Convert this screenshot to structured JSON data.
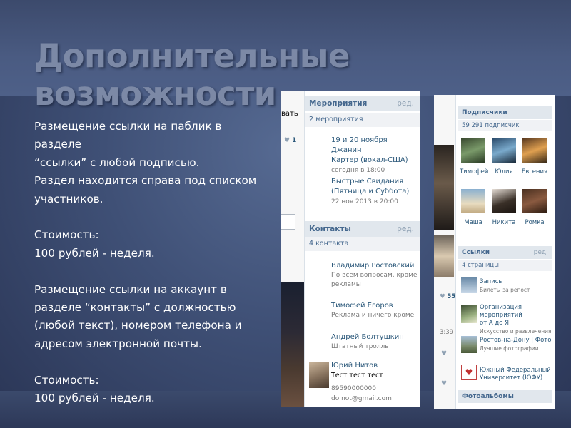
{
  "slide": {
    "title": "Дополнительные возможности",
    "paragraphs": [
      [
        "Размещение ссылки на паблик в разделе",
        "“ссылки” с любой подписью.",
        "Раздел находится справа под списком",
        "участников."
      ],
      [
        "Стоимость:",
        "100 рублей - неделя."
      ],
      [
        "Размещение ссылки на аккаунт в",
        "разделе “контакты” с должностью",
        "(любой текст), номером телефона и",
        "адресом электронной почты."
      ],
      [
        "Стоимость:",
        "100 рублей - неделя."
      ]
    ]
  },
  "screenshot_left": {
    "edge_fragment": "вать",
    "edge_like_count": "1",
    "events": {
      "header": "Мероприятия",
      "edit_label": "ред.",
      "count": "2 мероприятия",
      "items": [
        {
          "title_lines": [
            "19 и 20 ноября Джанин",
            "Картер (вокал-США)"
          ],
          "when": "сегодня в 18:00"
        },
        {
          "title_lines": [
            "Быстрые Свидания",
            "(Пятница и Суббота)"
          ],
          "when": "22 ноя 2013 в 20:00"
        }
      ]
    },
    "contacts": {
      "header": "Контакты",
      "edit_label": "ред.",
      "count": "4 контакта",
      "items": [
        {
          "name": "Владимир Ростовский",
          "role_lines": [
            "По всем вопросам, кроме",
            "рекламы"
          ]
        },
        {
          "name": "Тимофей Егоров",
          "role_lines": [
            "Реклама и ничего кроме"
          ]
        },
        {
          "name": "Андрей Болтушкин",
          "role_lines": [
            "Штатный тролль"
          ]
        },
        {
          "name": "Юрий Нитов",
          "role_lines": [
            "Тест тест тест"
          ],
          "phone": "89590000000",
          "email": "do not@gmail.com"
        }
      ]
    }
  },
  "screenshot_right": {
    "edge_like_count": "55",
    "edge_time": "3:39",
    "subscribers": {
      "header": "Подписчики",
      "count": "59 291 подписчик",
      "people": [
        "Тимофей",
        "Юлия",
        "Евгения",
        "Маша",
        "Никита",
        "Ромка"
      ]
    },
    "links": {
      "header": "Ссылки",
      "edit_label": "ред.",
      "count": "4 страницы",
      "items": [
        {
          "title_lines": [
            "Запись"
          ],
          "caption": "Билеты за репост"
        },
        {
          "title_lines": [
            "Организация мероприятий",
            "от А до Я"
          ],
          "caption": "Искусство и развлечения"
        },
        {
          "title_lines": [
            "Ростов-на-Дону | Фото"
          ],
          "caption": "Лучшие фотографии"
        },
        {
          "title_lines": [
            "Южный Федеральный",
            "Университет (ЮФУ)"
          ],
          "caption": ""
        }
      ]
    },
    "albums": {
      "header": "Фотоальбомы"
    }
  },
  "colors": {
    "slide_bg": "#3f5076",
    "title": "#7c89a6",
    "vk_header_bg": "#e1e7ed",
    "vk_link": "#2b587a"
  },
  "icons": [
    "heart-icon"
  ]
}
